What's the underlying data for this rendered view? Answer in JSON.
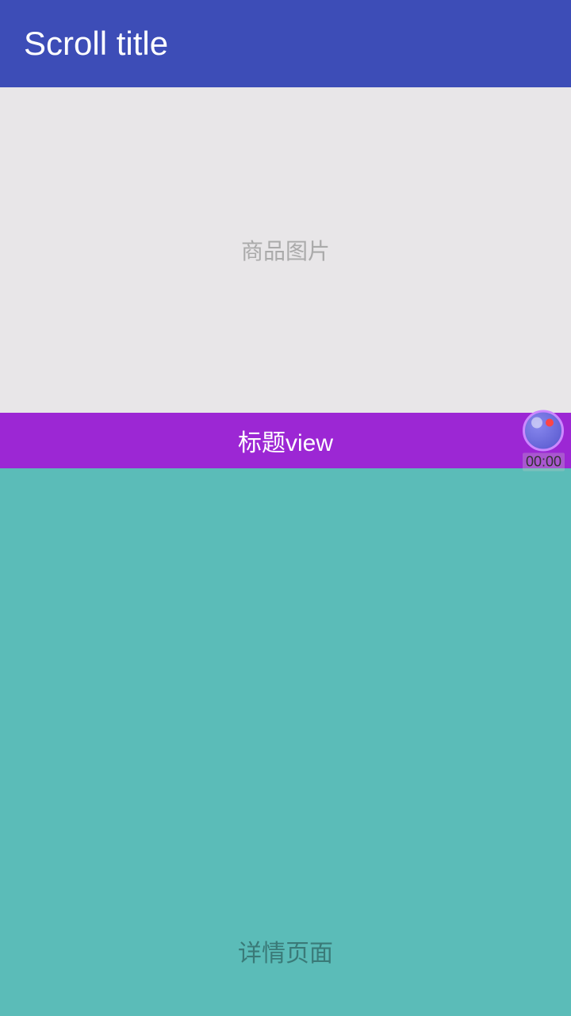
{
  "header": {
    "title": "Scroll title",
    "background_color": "#3d4db7"
  },
  "product_image_section": {
    "label": "商品图片",
    "background_color": "#e8e6e8"
  },
  "title_view_section": {
    "label": "标题view",
    "background_color": "#9c27d4"
  },
  "timer": {
    "time": "00:00"
  },
  "detail_section": {
    "label": "详情页面",
    "background_color": "#5bbcb8"
  }
}
